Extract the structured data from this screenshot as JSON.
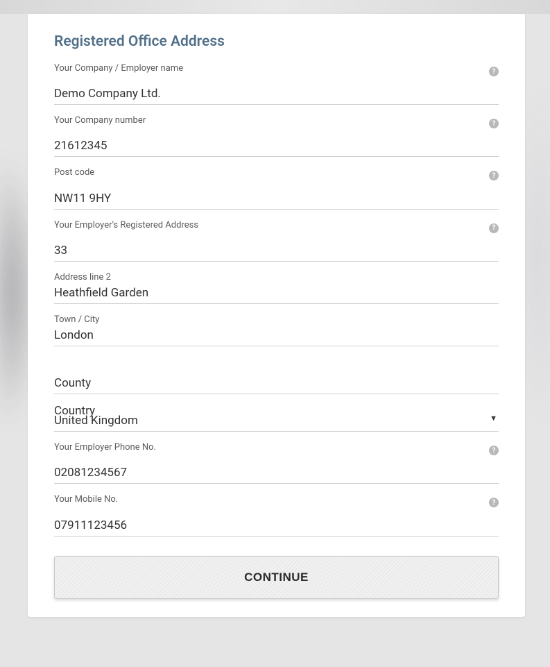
{
  "section_title": "Registered Office Address",
  "fields": {
    "company_name": {
      "label": "Your Company / Employer name",
      "value": "Demo Company Ltd."
    },
    "company_number": {
      "label": "Your Company number",
      "value": "21612345"
    },
    "postcode": {
      "label": "Post code",
      "value": "NW11 9HY"
    },
    "registered_address": {
      "label": "Your Employer's Registered Address",
      "value": "33"
    },
    "address_line_2": {
      "label": "Address line 2",
      "value": "Heathfield Garden"
    },
    "town_city": {
      "label": "Town / City",
      "value": "London"
    },
    "county": {
      "label": "County",
      "value": ""
    },
    "country": {
      "label": "Country",
      "value": "United Kingdom"
    },
    "employer_phone": {
      "label": "Your Employer Phone No.",
      "value": "02081234567"
    },
    "mobile_no": {
      "label": "Your Mobile No.",
      "value": "07911123456"
    }
  },
  "continue_label": "CONTINUE",
  "help_glyph": "?"
}
